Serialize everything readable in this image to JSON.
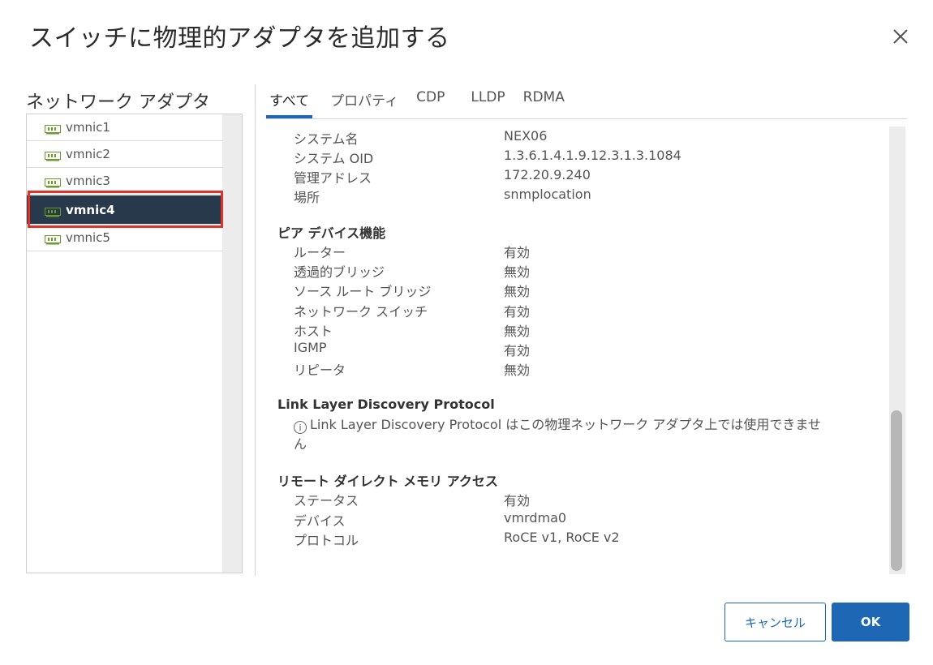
{
  "dialog": {
    "title": "スイッチに物理的アダプタを追加する"
  },
  "left_panel": {
    "title": "ネットワーク アダプタ",
    "items": [
      {
        "label": "vmnic1",
        "selected": false
      },
      {
        "label": "vmnic2",
        "selected": false
      },
      {
        "label": "vmnic3",
        "selected": false
      },
      {
        "label": "vmnic4",
        "selected": true
      },
      {
        "label": "vmnic5",
        "selected": false
      }
    ],
    "icon": "network-card-icon"
  },
  "tabs": [
    {
      "label": "すべて",
      "active": true
    },
    {
      "label": "プロパティ",
      "active": false
    },
    {
      "label": "CDP",
      "active": false
    },
    {
      "label": "LLDP",
      "active": false
    },
    {
      "label": "RDMA",
      "active": false
    }
  ],
  "details": {
    "top_rows": [
      {
        "label": "システム名",
        "value": "NEX06"
      },
      {
        "label": "システム OID",
        "value": "1.3.6.1.4.1.9.12.3.1.3.1084"
      },
      {
        "label": "管理アドレス",
        "value": "172.20.9.240"
      },
      {
        "label": "場所",
        "value": "snmplocation"
      }
    ],
    "peer": {
      "title": "ピア デバイス機能",
      "rows": [
        {
          "label": "ルーター",
          "value": "有効"
        },
        {
          "label": "透過的ブリッジ",
          "value": "無効"
        },
        {
          "label": "ソース ルート ブリッジ",
          "value": "無効"
        },
        {
          "label": "ネットワーク スイッチ",
          "value": "有効"
        },
        {
          "label": "ホスト",
          "value": "無効"
        },
        {
          "label": "IGMP",
          "value": "有効"
        },
        {
          "label": "リピータ",
          "value": "無効"
        }
      ]
    },
    "lldp": {
      "title": "Link Layer Discovery Protocol",
      "info_line1": "Link Layer Discovery Protocol はこの物理ネットワーク アダプタ上では使用できませ",
      "info_line2": "ん"
    },
    "rdma": {
      "title": "リモート ダイレクト メモリ アクセス",
      "rows": [
        {
          "label": "ステータス",
          "value": "有効"
        },
        {
          "label": "デバイス",
          "value": "vmrdma0"
        },
        {
          "label": "プロトコル",
          "value": "RoCE v1, RoCE v2"
        }
      ]
    }
  },
  "buttons": {
    "cancel": "キャンセル",
    "ok": "OK"
  },
  "colors": {
    "accent": "#1d67b4",
    "selected_row": "#28394b",
    "highlight_outline": "#e03226",
    "nic_icon": "#6a9a2a"
  }
}
